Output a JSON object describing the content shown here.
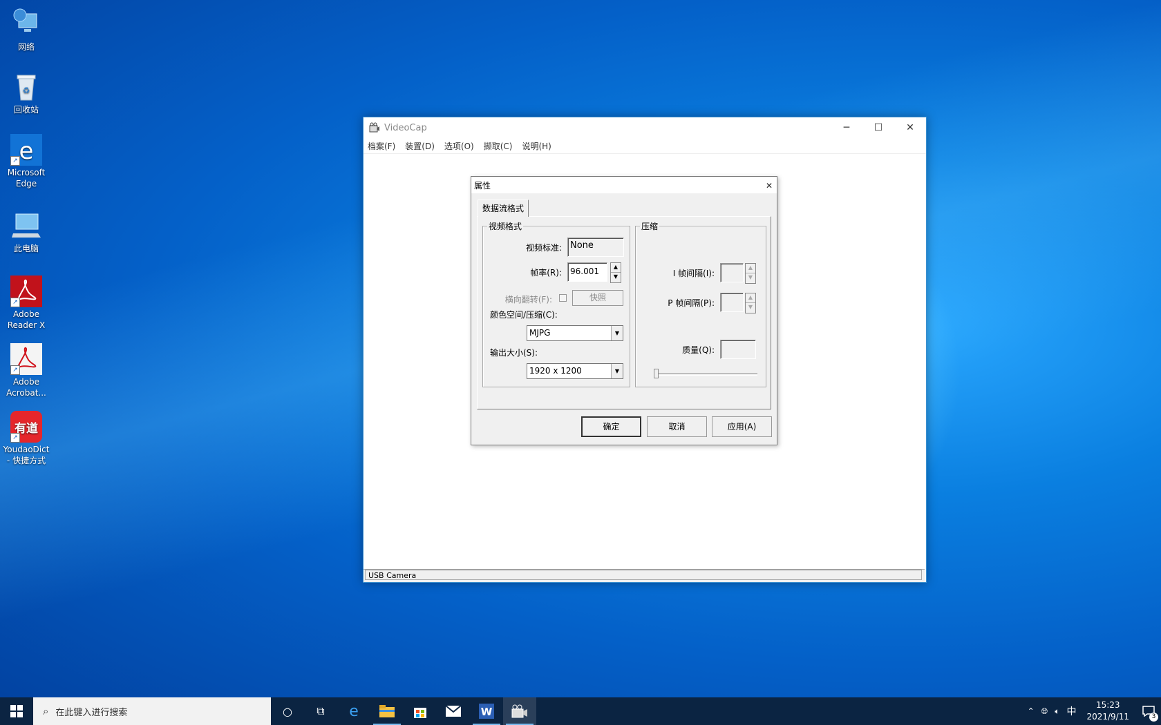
{
  "desktop": {
    "icons": [
      {
        "label": "网络",
        "icon": "network-icon"
      },
      {
        "label": "回收站",
        "icon": "recycle-bin-icon"
      },
      {
        "label": "Microsoft Edge",
        "icon": "edge-icon"
      },
      {
        "label": "此电脑",
        "icon": "this-pc-icon"
      },
      {
        "label": "Adobe Reader X",
        "icon": "adobe-reader-icon"
      },
      {
        "label": "Adobe Acrobat...",
        "icon": "adobe-acrobat-icon"
      },
      {
        "label": "YoudaoDict - 快捷方式",
        "icon": "youdao-icon"
      }
    ]
  },
  "window": {
    "title": "VideoCap",
    "menu": [
      "档案(F)",
      "装置(D)",
      "选项(O)",
      "撷取(C)",
      "说明(H)"
    ],
    "status": "USB Camera"
  },
  "dialog": {
    "title": "属性",
    "tab": "数据流格式",
    "video_group": {
      "label": "视频格式",
      "standard_label": "视频标准:",
      "standard_value": "None",
      "framerate_label": "帧率(R):",
      "framerate_value": "96.001",
      "flip_label": "横向翻转(F):",
      "snapshot_button": "快照",
      "colorspace_label": "颜色空间/压缩(C):",
      "colorspace_value": "MJPG",
      "output_label": "输出大小(S):",
      "output_value": "1920 x 1200"
    },
    "compress_group": {
      "label": "压缩",
      "i_interval_label": "I 帧间隔(I):",
      "p_interval_label": "P 帧间隔(P):",
      "quality_label": "质量(Q):"
    },
    "buttons": {
      "ok": "确定",
      "cancel": "取消",
      "apply": "应用(A)"
    }
  },
  "taskbar": {
    "search_placeholder": "在此键入进行搜索",
    "ime": "中",
    "time": "15:23",
    "date": "2021/9/11",
    "notification_count": "3"
  }
}
